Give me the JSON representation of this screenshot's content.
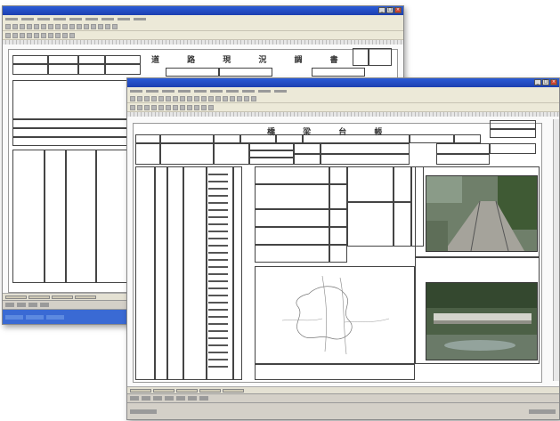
{
  "back_window": {
    "title": "",
    "win_buttons": [
      "_",
      "□",
      "×"
    ],
    "sheet_title": "道 路 現 況 調 書"
  },
  "front_window": {
    "title": "",
    "win_buttons": [
      "_",
      "□",
      "×"
    ],
    "sheet_title": "橋 梁 台 帳"
  },
  "colors": {
    "titlebar": "#2a5bd7",
    "chrome": "#ece9d8",
    "status": "#d4d0c8"
  }
}
